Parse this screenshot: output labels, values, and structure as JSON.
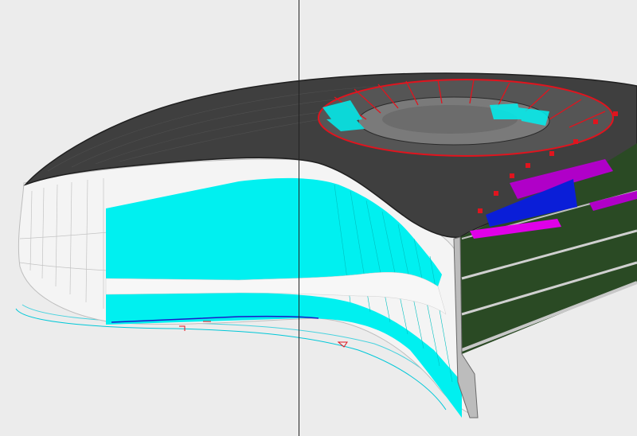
{
  "viewport": {
    "background": "#ececec",
    "split_divider_color": "#222222"
  },
  "model": {
    "roof_color": "#3f3f3f",
    "roof_edge_color": "#1f1f1f",
    "facade_white": "#f4f4f4",
    "glazing_cyan": "#00f0f0",
    "grid_line_color": "#9a9a9a",
    "section_cut_red": "#e0141e",
    "floor_slab_green": "#2a4a24",
    "purple_band": "#b000c8",
    "blue_panel": "#0a1ed8",
    "outline_cyan": "#00c8d8",
    "icons": [
      "roof-oculus-icon",
      "ground-marker-icon"
    ]
  }
}
